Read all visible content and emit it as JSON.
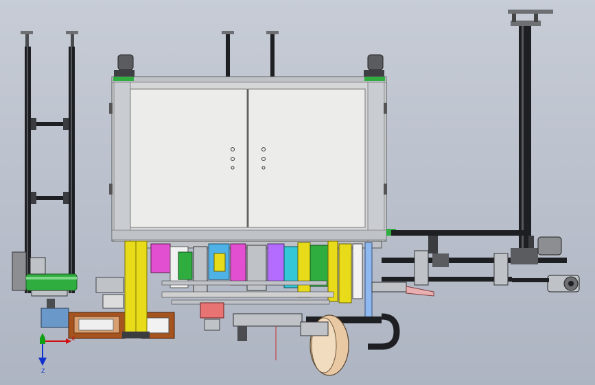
{
  "viewport": {
    "background_top": "#c7ccd6",
    "background_bottom": "#aeb5c2"
  },
  "triad": {
    "x_label": "X",
    "z_label": "Z",
    "colors": {
      "x": "#d01010",
      "y": "#12a012",
      "z": "#1030d0"
    }
  },
  "cabinet": {
    "door_count": 2,
    "frame_color": "#d4d6d8",
    "panel_color": "#ececea"
  },
  "colors": {
    "frame_dark": "#1e1f22",
    "aluminium": "#bfc3c8",
    "yellow": "#e8dc1a",
    "green": "#2fae3f",
    "magenta": "#e24fd0",
    "cyan": "#33c7d8",
    "orange_brown": "#a5531f",
    "wheel": "#e8c9a3"
  }
}
